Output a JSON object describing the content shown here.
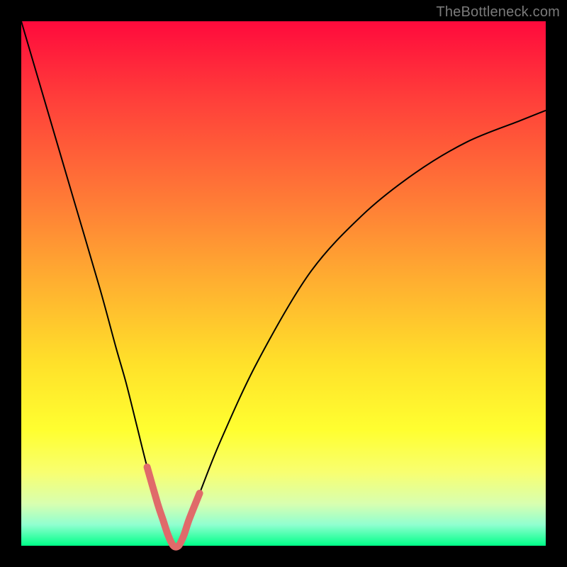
{
  "watermark": "TheBottleneck.com",
  "chart_data": {
    "type": "line",
    "title": "",
    "xlabel": "",
    "ylabel": "",
    "xlim": [
      0,
      100
    ],
    "ylim": [
      0,
      100
    ],
    "grid": false,
    "legend": false,
    "series": [
      {
        "name": "bottleneck-curve",
        "color": "#000000",
        "stroke_width": 2,
        "x": [
          0,
          5,
          10,
          15,
          18,
          20,
          22,
          24,
          26,
          27,
          28,
          29,
          30,
          31,
          32,
          34,
          38,
          45,
          55,
          65,
          75,
          85,
          95,
          100
        ],
        "values": [
          100,
          83,
          66,
          49,
          38,
          31,
          23,
          15,
          8,
          5,
          2,
          0,
          0,
          2,
          5,
          10,
          20,
          35,
          52,
          63,
          71,
          77,
          81,
          83
        ]
      },
      {
        "name": "bottleneck-marker",
        "color": "#e06a6a",
        "stroke_width": 10,
        "linecap": "round",
        "x": [
          24,
          26,
          27,
          28,
          29,
          30,
          31,
          32,
          34
        ],
        "values": [
          15,
          8,
          5,
          2,
          0,
          0,
          2,
          5,
          10
        ]
      }
    ],
    "background_gradient": {
      "direction": "vertical",
      "stops": [
        {
          "pos": 0.0,
          "color": "#ff0a3c"
        },
        {
          "pos": 0.15,
          "color": "#ff3f3a"
        },
        {
          "pos": 0.35,
          "color": "#ff7e36"
        },
        {
          "pos": 0.5,
          "color": "#ffb030"
        },
        {
          "pos": 0.65,
          "color": "#ffe02a"
        },
        {
          "pos": 0.78,
          "color": "#ffff30"
        },
        {
          "pos": 0.86,
          "color": "#f8ff70"
        },
        {
          "pos": 0.92,
          "color": "#d8ffb0"
        },
        {
          "pos": 0.96,
          "color": "#90ffd0"
        },
        {
          "pos": 1.0,
          "color": "#00ff88"
        }
      ]
    }
  }
}
